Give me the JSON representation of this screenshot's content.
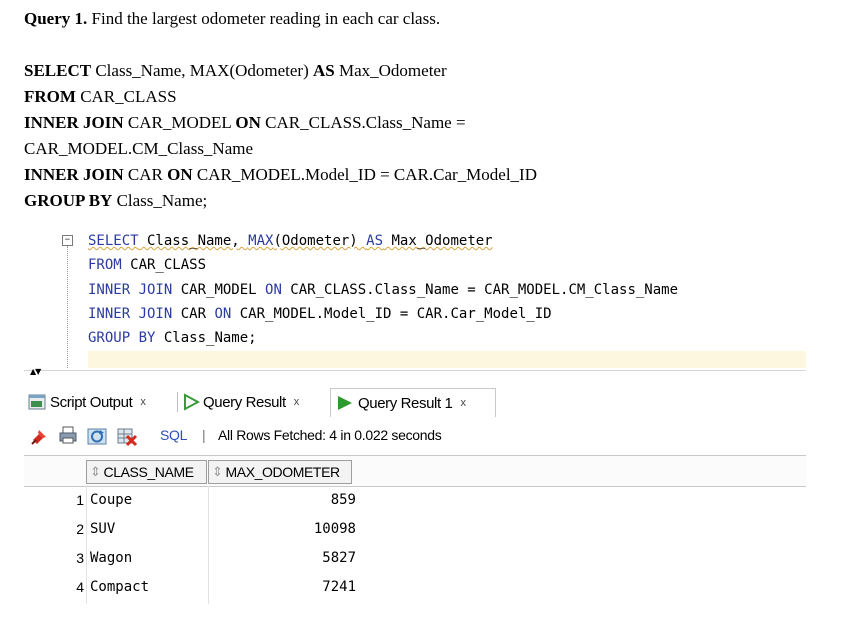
{
  "doc": {
    "query_label": "Query 1.",
    "query_text": "Find the largest odometer reading in each car class.",
    "sql_lines": [
      {
        "kw": "SELECT",
        "rest": " Class_Name, MAX(Odometer) ",
        "kw2": "AS",
        "rest2": " Max_Odometer"
      },
      {
        "kw": "FROM",
        "rest": " CAR_CLASS",
        "kw2": "",
        "rest2": ""
      },
      {
        "kw": "INNER JOIN",
        "rest": " CAR_MODEL ",
        "kw2": "ON",
        "rest2": " CAR_CLASS.Class_Name ="
      },
      {
        "kw": "",
        "rest": "CAR_MODEL.CM_Class_Name",
        "kw2": "",
        "rest2": ""
      },
      {
        "kw": "INNER JOIN",
        "rest": " CAR ",
        "kw2": "ON",
        "rest2": " CAR_MODEL.Model_ID = CAR.Car_Model_ID"
      },
      {
        "kw": "GROUP BY",
        "rest": " Class_Name;",
        "kw2": "",
        "rest2": ""
      }
    ]
  },
  "editor": {
    "collapse_glyph": "−",
    "lines": {
      "l1_kw": "SELECT",
      "l1_a": " Class_Name, ",
      "l1_fn": "MAX",
      "l1_b": "(Odometer) ",
      "l1_kw2": "AS",
      "l1_c": " Max_Odometer",
      "l2_kw": "FROM",
      "l2_a": " CAR_CLASS",
      "l3_kw": "INNER JOIN",
      "l3_a": " CAR_MODEL ",
      "l3_kw2": "ON",
      "l3_b": " CAR_CLASS.Class_Name = CAR_MODEL.CM_Class_Name",
      "l4_kw": "INNER JOIN",
      "l4_a": " CAR ",
      "l4_kw2": "ON",
      "l4_b": " CAR_MODEL.Model_ID = CAR.Car_Model_ID",
      "l5_kw": "GROUP BY",
      "l5_a": " Class_Name;"
    }
  },
  "tabs": [
    {
      "label": "Script Output",
      "close": "x"
    },
    {
      "label": "Query Result",
      "close": "x"
    },
    {
      "label": "Query Result 1",
      "close": "x"
    }
  ],
  "toolbar": {
    "sql_link": "SQL",
    "divider": "|",
    "status": "All Rows Fetched: 4 in 0.022 seconds"
  },
  "grid": {
    "columns": [
      "CLASS_NAME",
      "MAX_ODOMETER"
    ],
    "rows": [
      {
        "n": "1",
        "class": "Coupe",
        "max": "859"
      },
      {
        "n": "2",
        "class": "SUV",
        "max": "10098"
      },
      {
        "n": "3",
        "class": "Wagon",
        "max": "5827"
      },
      {
        "n": "4",
        "class": "Compact",
        "max": "7241"
      }
    ]
  },
  "colors": {
    "keyword": "#2b3ba0",
    "squiggle": "#d9a441",
    "current_line": "#fdf7df"
  },
  "icons": [
    "script-icon",
    "play-icon",
    "pin-icon",
    "print-icon",
    "refresh-icon",
    "export-icon",
    "sort-icon",
    "splitter-arrows-icon"
  ]
}
